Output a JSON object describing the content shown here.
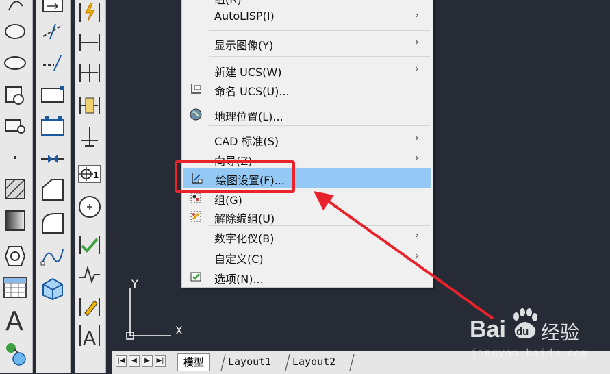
{
  "menu": {
    "items": [
      {
        "label": "组(R)",
        "submenu": false,
        "icon": "group-icon"
      },
      {
        "label": "AutoLISP(I)",
        "submenu": true,
        "icon": ""
      },
      {
        "label": "显示图像(Y)",
        "submenu": true,
        "icon": ""
      },
      {
        "label": "新建 UCS(W)",
        "submenu": true,
        "icon": ""
      },
      {
        "label": "命名 UCS(U)...",
        "submenu": false,
        "icon": "named-ucs-icon"
      },
      {
        "label": "地理位置(L)...",
        "submenu": false,
        "icon": "globe-icon"
      },
      {
        "label": "CAD 标准(S)",
        "submenu": true,
        "icon": ""
      },
      {
        "label": "向导(Z)",
        "submenu": true,
        "icon": ""
      },
      {
        "label": "绘图设置(F)...",
        "submenu": false,
        "icon": "drafting-settings-icon"
      },
      {
        "label": "组(G)",
        "submenu": false,
        "icon": "group-icon"
      },
      {
        "label": "解除编组(U)",
        "submenu": false,
        "icon": "ungroup-icon"
      },
      {
        "label": "数字化仪(B)",
        "submenu": true,
        "icon": ""
      },
      {
        "label": "自定义(C)",
        "submenu": true,
        "icon": ""
      },
      {
        "label": "选项(N)...",
        "submenu": false,
        "icon": "options-check-icon"
      }
    ],
    "arrow": "›",
    "highlighted_index": 8
  },
  "ucs_axes": {
    "y": "Y",
    "x": "X"
  },
  "tabs": {
    "nav": [
      "|◀",
      "◀",
      "▶",
      "▶|"
    ],
    "items": [
      "模型",
      "Layout1",
      "Layout2"
    ],
    "active": "模型"
  },
  "watermark": {
    "brand": "Bai",
    "paw": "du",
    "cn": "经验",
    "url": "jingyan.baidu.com"
  },
  "colors": {
    "highlight": "#93c9f4",
    "annotation": "#e8232c",
    "canvas": "#262b35",
    "ucs": "#ffffff"
  }
}
